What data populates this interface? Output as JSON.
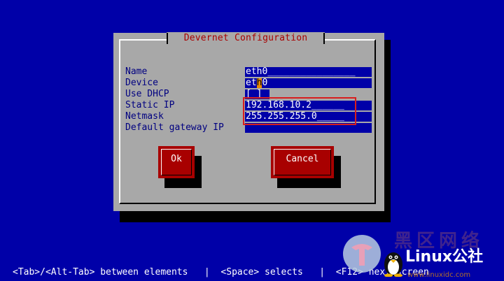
{
  "dialog": {
    "title": "Devernet Configuration"
  },
  "fields": [
    {
      "label": "Name",
      "value_pre": "eth0",
      "value_cursor": "",
      "value_post": "________________"
    },
    {
      "label": "Device",
      "value_pre": "et",
      "value_cursor": "h",
      "value_post": "0"
    },
    {
      "label": "Use DHCP",
      "value": "[ ]"
    },
    {
      "label": "Static IP",
      "value": "192.168.10.2______"
    },
    {
      "label": "Netmask",
      "value": "255.255.255.0_____"
    },
    {
      "label": "Default gateway IP",
      "value": ""
    }
  ],
  "buttons": {
    "ok": "Ok",
    "cancel": "Cancel"
  },
  "status_bar": {
    "text": "<Tab>/<Alt-Tab> between elements   |  <Space> selects   |  <F12> next screen"
  },
  "watermark": {
    "cn_text": "黑区网络",
    "brand": "Linux公社",
    "url": "www.linuxidc.com"
  },
  "colors": {
    "background": "#0000a8",
    "dialog": "#a8a8a8",
    "label": "#000080",
    "button": "#a80000",
    "highlight_box": "#d81e1e"
  }
}
